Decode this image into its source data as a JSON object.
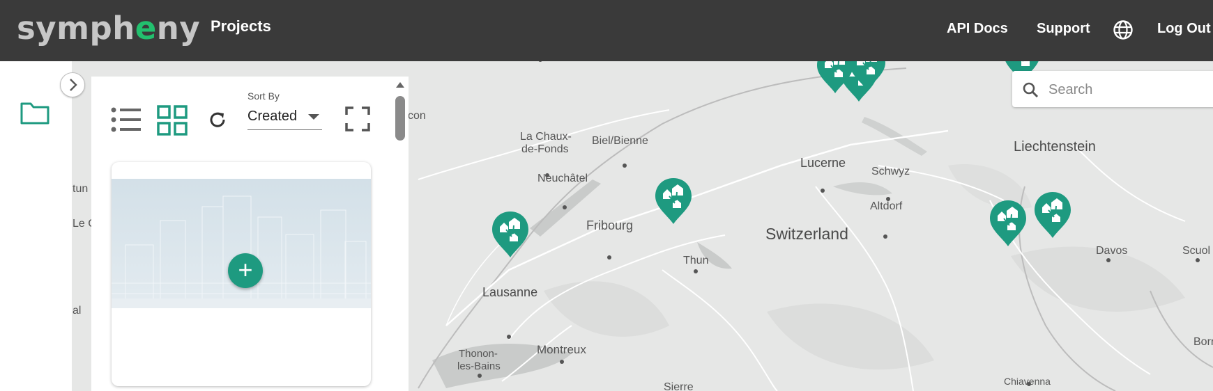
{
  "header": {
    "logo_pre": "symph",
    "logo_accent": "e",
    "logo_post": "ny",
    "nav_projects": "Projects",
    "api_docs": "API Docs",
    "support": "Support",
    "logout": "Log Out",
    "language_icon": "globe-icon"
  },
  "sidebar": {
    "folder_icon": "folder-icon",
    "collapse_icon": "chevron-right-icon"
  },
  "projects_panel": {
    "sort_by_label": "Sort By",
    "sort_by_value": "Created",
    "list_view_icon": "list-icon",
    "grid_view_icon": "grid-icon",
    "refresh_icon": "refresh-icon",
    "fullscreen_icon": "fullscreen-icon",
    "new_project_icon": "plus-icon"
  },
  "map": {
    "search_placeholder": "Search",
    "labels": [
      "La Chaux-de-Fonds",
      "Biel/Bienne",
      "Neuchâtel",
      "Lucerne",
      "Schwyz",
      "Liechtenstein",
      "Altdorf",
      "Fribourg",
      "Thun",
      "Switzerland",
      "Davos",
      "Scuol",
      "Lausanne",
      "Montreux",
      "Thonon-les-Bains",
      "Sierre",
      "Chiavenna",
      "Borr",
      "con",
      "tun",
      "Le C",
      "al"
    ],
    "pin_icon": "project-pin-icon"
  },
  "colors": {
    "brand": "#1e9a80",
    "logo_accent": "#22c06e",
    "topbar": "#3a3a3a"
  }
}
